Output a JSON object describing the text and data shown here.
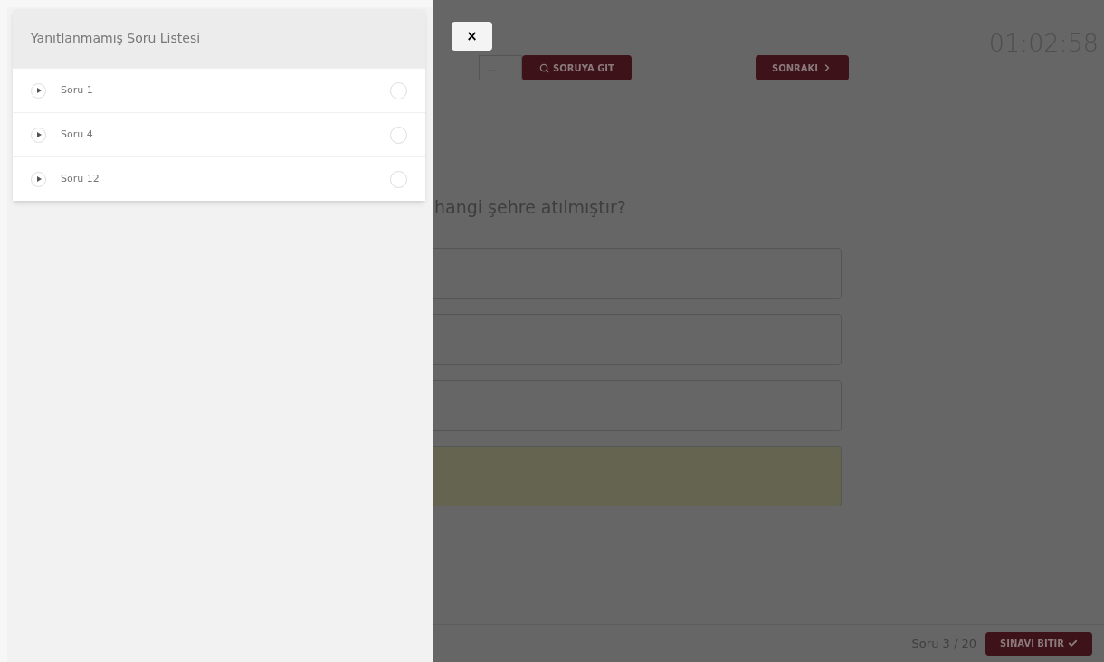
{
  "drawer": {
    "title": "Yanıtlanmamış Soru Listesi",
    "items": [
      {
        "label": "Soru 1",
        "selected": false
      },
      {
        "label": "Soru 4",
        "selected": false
      },
      {
        "label": "Soru 12",
        "selected": false
      }
    ]
  },
  "close": {
    "label": "×"
  },
  "navigation": {
    "goto_placeholder": "...",
    "goto_button": "SORUYA GIT",
    "next_button": "SONRAKI"
  },
  "timer": "01:02:58",
  "question": {
    "text": "hangi şehre atılmıştır?",
    "options": [
      {
        "selected": false
      },
      {
        "selected": false
      },
      {
        "selected": false
      },
      {
        "selected": true
      }
    ]
  },
  "footer": {
    "counter": "Soru 3 / 20",
    "finish_button": "SINAVI BITIR"
  }
}
